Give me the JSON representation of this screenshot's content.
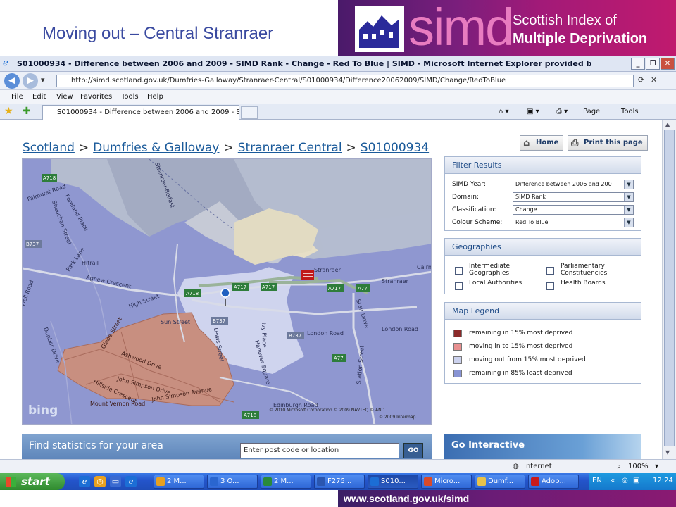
{
  "slide": {
    "title": "Moving out – Central Stranraer",
    "brand": {
      "name": "simd",
      "line1": "Scottish Index of",
      "line2": "Multiple Deprivation"
    },
    "footer_url": "www.scotland.gov.uk/simd"
  },
  "browser": {
    "window_title": "S01000934 - Difference between 2006 and 2009 - SIMD Rank - Change - Red To Blue | SIMD - Microsoft Internet Explorer provided b",
    "address": "http://simd.scotland.gov.uk/Dumfries-Galloway/Stranraer-Central/S01000934/Difference20062009/SIMD/Change/RedToBlue",
    "menu": [
      "File",
      "Edit",
      "View",
      "Favorites",
      "Tools",
      "Help"
    ],
    "tab_title": "S01000934 - Difference between 2006 and 2009 - SI...",
    "commands": {
      "page": "Page",
      "tools": "Tools"
    },
    "status": {
      "zone": "Internet",
      "zoom": "100%"
    }
  },
  "page": {
    "breadcrumb": [
      "Scotland",
      "Dumfries & Galloway",
      "Stranraer Central",
      "S01000934"
    ],
    "home_button": "Home",
    "print_button": "Print this page",
    "filter": {
      "heading": "Filter Results",
      "rows": [
        {
          "label": "SIMD Year:",
          "value": "Difference between 2006 and 200"
        },
        {
          "label": "Domain:",
          "value": "SIMD Rank"
        },
        {
          "label": "Classification:",
          "value": "Change"
        },
        {
          "label": "Colour Scheme:",
          "value": "Red To Blue"
        }
      ]
    },
    "geographies": {
      "heading": "Geographies",
      "options": [
        {
          "label": "Intermediate Geographies"
        },
        {
          "label": "Parliamentary Constituencies"
        },
        {
          "label": "Local Authorities"
        },
        {
          "label": "Health Boards"
        }
      ]
    },
    "legend": {
      "heading": "Map Legend",
      "items": [
        {
          "label": "remaining in 15% most deprived",
          "color": "#8b2a2a"
        },
        {
          "label": "moving in to 15% most deprived",
          "color": "#e89090"
        },
        {
          "label": "moving out from 15% most deprived",
          "color": "#ccd2ee"
        },
        {
          "label": "remaining in 85% least deprived",
          "color": "#8894d4"
        }
      ]
    },
    "find": {
      "label": "Find statistics for your area",
      "placeholder": "Enter post code or location",
      "go": "GO"
    },
    "interactive": "Go Interactive",
    "map": {
      "logo": "bing",
      "copyright1": "© 2010 Microsoft Corporation   © 2009 NAVTEQ   © AND",
      "copyright2": "© 2009 Intermap",
      "roads": {
        "a718_top": "A718",
        "b737_left": "B737",
        "a718_mid": "A718",
        "a717_a": "A717",
        "a717_b": "A717",
        "a717_c": "A717",
        "a77_a": "A77",
        "b737_mid": "B737",
        "b737_low": "B737",
        "a77_b": "A77",
        "a718_bot": "A718",
        "stranraer1": "Stranraer",
        "stranraer2": "Stranraer",
        "cairn": "Cairn",
        "agnew": "Agnew Crescent",
        "sun": "Sun Street",
        "london1": "London Road",
        "london2": "London Road",
        "station": "Station Street",
        "stair": "Stair Drive",
        "lewis": "Lewis Street",
        "hanover": "Hanover Square",
        "ashwood": "Ashwood Drive",
        "johnsimpson1": "John Simpson Drive",
        "johnsimpson2": "John Simpson Avenue",
        "hillside": "Hillside Crescent",
        "mountvernon": "Mount Vernon Road",
        "edinburgh": "Edinburgh Road",
        "highstreet": "High Street",
        "parklane": "Park Lane",
        "belfast": "Stranraer-Belfast",
        "forehill": "Foreland Place",
        "glebe": "Glebe Street",
        "sheuchan": "Sheuchan Street",
        "fairhurst": "Fairhurst Road",
        "well": "Well Road",
        "dunbar": "Dunbar Drive",
        "hitrail": "Hitrail",
        "ivy": "Ivy Place"
      }
    }
  },
  "taskbar": {
    "start": "start",
    "buttons": [
      {
        "label": "2 M..."
      },
      {
        "label": "3 O..."
      },
      {
        "label": "2 M..."
      },
      {
        "label": "F275..."
      },
      {
        "label": "S010..."
      },
      {
        "label": "Micro..."
      },
      {
        "label": "Dumf..."
      },
      {
        "label": "Adob..."
      }
    ],
    "language": "EN",
    "clock": "12:24"
  }
}
